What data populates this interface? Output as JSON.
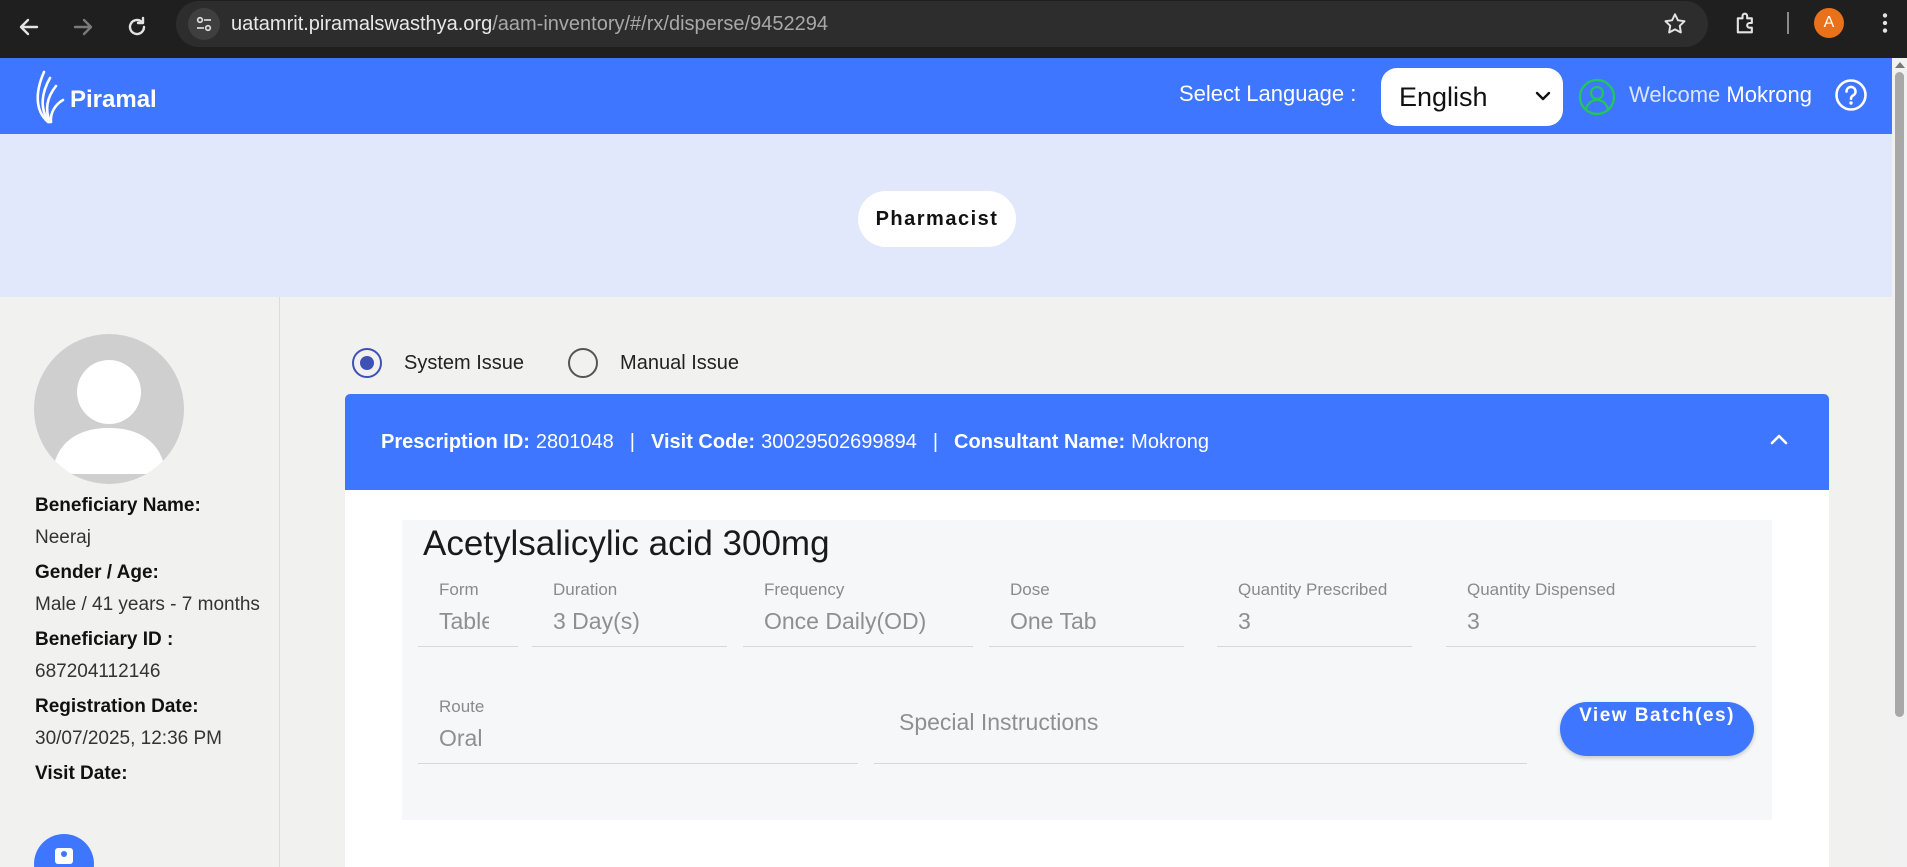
{
  "browser": {
    "url_host": "uatamrit.piramalswasthya.org",
    "url_path": "/aam-inventory/#/rx/disperse/9452294",
    "profile_initial": "A"
  },
  "header": {
    "logo_text": "Piramal",
    "language_label": "Select Language :",
    "language_selected": "English",
    "welcome_prefix": "Welcome",
    "user_name": "Mokrong"
  },
  "role": "Pharmacist",
  "beneficiary": {
    "name_label": "Beneficiary Name:",
    "name": "Neeraj",
    "gender_age_label": "Gender / Age:",
    "gender_age": "Male / 41 years - 7 months",
    "id_label": "Beneficiary ID :",
    "id": "687204112146",
    "reg_date_label": "Registration Date:",
    "reg_date": "30/07/2025, 12:36 PM",
    "visit_date_label": "Visit Date:"
  },
  "issue_options": {
    "system": "System Issue",
    "manual": "Manual Issue",
    "selected": "system"
  },
  "prescription": {
    "id_label": "Prescription ID:",
    "id": "2801048",
    "visit_code_label": "Visit Code:",
    "visit_code": "30029502699894",
    "consultant_label": "Consultant Name:",
    "consultant": "Mokrong"
  },
  "drug": {
    "name": "Acetylsalicylic acid 300mg",
    "form_label": "Form",
    "form": "Tablet",
    "duration_label": "Duration",
    "duration": "3 Day(s)",
    "frequency_label": "Frequency",
    "frequency": "Once Daily(OD)",
    "dose_label": "Dose",
    "dose": "One Tab",
    "qty_prescribed_label": "Quantity Prescribed",
    "qty_prescribed": "3",
    "qty_dispensed_label": "Quantity Dispensed",
    "qty_dispensed": "3",
    "route_label": "Route",
    "route": "Oral",
    "special_instructions_placeholder": "Special Instructions",
    "view_batch_label": "View Batch(es)"
  },
  "colors": {
    "primary": "#3f76ff",
    "banner": "#e2e8fc",
    "radio_checked": "#3f51b5"
  }
}
